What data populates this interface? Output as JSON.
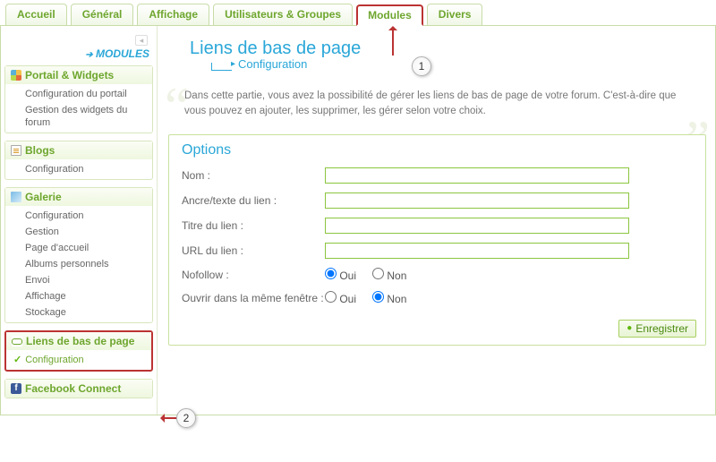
{
  "tabs": [
    "Accueil",
    "Général",
    "Affichage",
    "Utilisateurs & Groupes",
    "Modules",
    "Divers"
  ],
  "modules_label": "MODULES",
  "sidebar": [
    {
      "title": "Portail & Widgets",
      "icon": "portail",
      "items": [
        "Configuration du portail",
        "Gestion des widgets du forum"
      ]
    },
    {
      "title": "Blogs",
      "icon": "blog",
      "items": [
        "Configuration"
      ]
    },
    {
      "title": "Galerie",
      "icon": "gal",
      "items": [
        "Configuration",
        "Gestion",
        "Page d'accueil",
        "Albums personnels",
        "Envoi",
        "Affichage",
        "Stockage"
      ]
    },
    {
      "title": "Liens de bas de page",
      "icon": "link",
      "active": true,
      "items": [
        "Configuration"
      ]
    },
    {
      "title": "Facebook Connect",
      "icon": "fb",
      "items": []
    }
  ],
  "page": {
    "title": "Liens de bas de page",
    "subtitle": "Configuration",
    "description": "Dans cette partie, vous avez la possibilité de gérer les liens de bas de page de votre forum. C'est-à-dire que vous pouvez en ajouter, les supprimer, les gérer selon votre choix."
  },
  "options": {
    "heading": "Options",
    "fields": {
      "name_label": "Nom :",
      "anchor_label": "Ancre/texte du lien :",
      "title_label": "Titre du lien :",
      "url_label": "URL du lien :",
      "nofollow_label": "Nofollow :",
      "samewin_label": "Ouvrir dans la même fenêtre :"
    },
    "radio_yes": "Oui",
    "radio_no": "Non",
    "nofollow_value": "Oui",
    "samewin_value": "Non",
    "save_label": "Enregistrer"
  },
  "badges": {
    "one": "1",
    "two": "2"
  }
}
